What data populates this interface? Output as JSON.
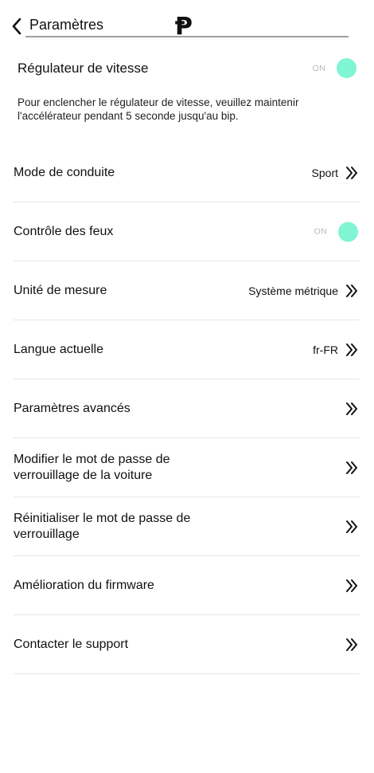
{
  "header": {
    "title": "Paramètres",
    "logo_text": "Ᵽ"
  },
  "cruise": {
    "label": "Régulateur de vitesse",
    "toggle_text": "ON",
    "toggle_state": true,
    "description": "Pour enclencher le régulateur de vitesse, veuillez maintenir l'accélérateur pendant 5 seconde jusqu'au bip."
  },
  "settings": {
    "drive_mode": {
      "label": "Mode de conduite",
      "value": "Sport"
    },
    "lights": {
      "label": "Contrôle des feux",
      "toggle_text": "ON",
      "toggle_state": true
    },
    "units": {
      "label": "Unité de mesure",
      "value": "Système métrique"
    },
    "language": {
      "label": "Langue actuelle",
      "value": "fr-FR"
    },
    "advanced": {
      "label": "Paramètres avancés"
    },
    "change_lock_password": {
      "label": "Modifier le mot de passe de verrouillage de la voiture"
    },
    "reset_lock_password": {
      "label": "Réinitialiser le mot de passe de verrouillage"
    },
    "firmware": {
      "label": "Amélioration du firmware"
    },
    "support": {
      "label": "Contacter le support"
    }
  },
  "colors": {
    "toggle_on": "#80f5d4",
    "divider": "#e6e6e6",
    "toggle_text": "#b8b8b8"
  },
  "icons": {
    "back": "chevron-left-icon",
    "row_chevron": "double-chevron-right-icon"
  }
}
